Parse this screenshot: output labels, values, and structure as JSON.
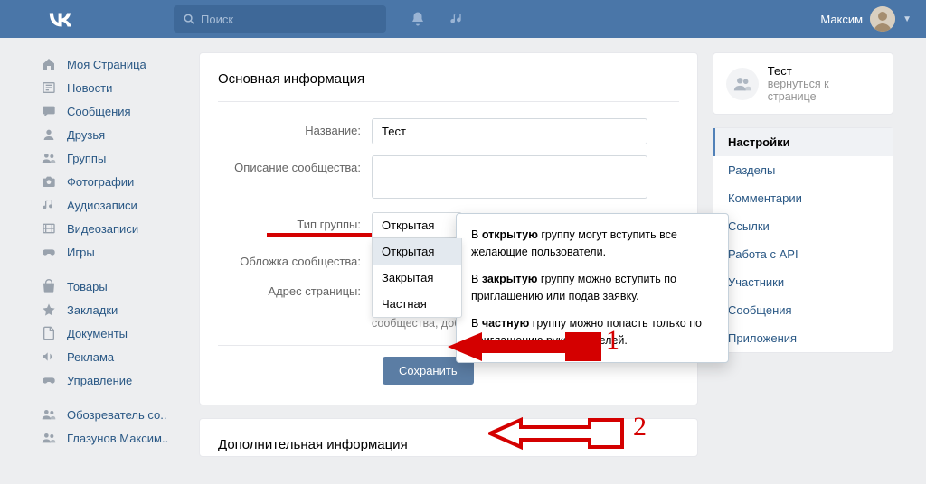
{
  "topbar": {
    "search_placeholder": "Поиск",
    "username": "Максим"
  },
  "left_nav": {
    "items": [
      {
        "icon": "home-icon",
        "label": "Моя Страница"
      },
      {
        "icon": "newspaper-icon",
        "label": "Новости"
      },
      {
        "icon": "speech-icon",
        "label": "Сообщения"
      },
      {
        "icon": "person-icon",
        "label": "Друзья"
      },
      {
        "icon": "group-icon",
        "label": "Группы"
      },
      {
        "icon": "camera-icon",
        "label": "Фотографии"
      },
      {
        "icon": "music-icon",
        "label": "Аудиозаписи"
      },
      {
        "icon": "film-icon",
        "label": "Видеозаписи"
      },
      {
        "icon": "gamepad-icon",
        "label": "Игры"
      }
    ],
    "items2": [
      {
        "icon": "bag-icon",
        "label": "Товары"
      },
      {
        "icon": "star-icon",
        "label": "Закладки"
      },
      {
        "icon": "doc-icon",
        "label": "Документы"
      },
      {
        "icon": "horn-icon",
        "label": "Реклама"
      },
      {
        "icon": "gamepad-icon",
        "label": "Управление"
      }
    ],
    "items3": [
      {
        "icon": "group-icon",
        "label": "Обозреватель со.."
      },
      {
        "icon": "group-icon",
        "label": "Глазунов Максим.."
      }
    ]
  },
  "main": {
    "title": "Основная информация",
    "name_label": "Название:",
    "name_value": "Тест",
    "desc_label": "Описание сообщества:",
    "type_label": "Тип группы:",
    "type_selected": "Открытая",
    "type_options": [
      "Открытая",
      "Закрытая",
      "Частная"
    ],
    "cover_label": "Обложка сообщества:",
    "address_label": "Адрес страницы:",
    "address_hint": "Вы можете создать наклейки для Вашего сообщества, добавив странице короткий адрес.",
    "save_button": "Сохранить",
    "second_title": "Дополнительная информация"
  },
  "popover": {
    "p1a": "В ",
    "p1b": "открытую",
    "p1c": " группу могут вступить все желающие пользователи.",
    "p2a": "В ",
    "p2b": "закрытую",
    "p2c": " группу можно вступить по приглашению или подав заявку.",
    "p3a": "В ",
    "p3b": "частную",
    "p3c": " группу можно попасть только по приглашению руководителей."
  },
  "right": {
    "group_name": "Тест",
    "group_sub": "вернуться к странице",
    "nav": [
      "Настройки",
      "Разделы",
      "Комментарии",
      "Ссылки",
      "Работа с API",
      "Участники",
      "Сообщения",
      "Приложения"
    ],
    "active_index": 0
  },
  "annotations": {
    "label1": "1",
    "label2": "2"
  }
}
